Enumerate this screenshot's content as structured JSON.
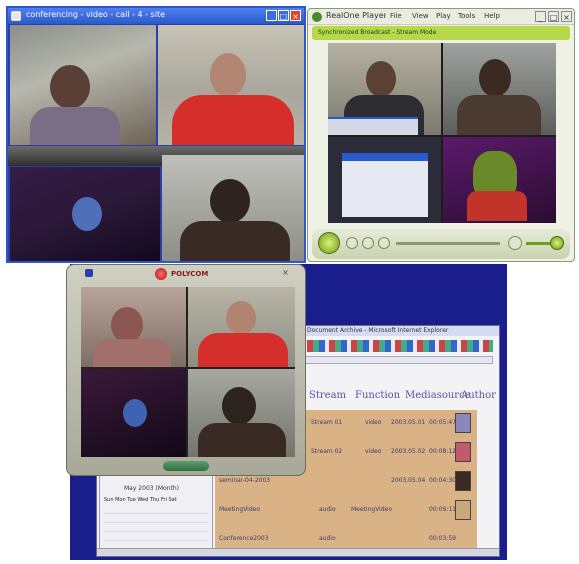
{
  "window_top_left": {
    "title": "conferencing - video - call - 4 - site",
    "tiles": [
      "participant-headset-woman",
      "participant-red-shirt-man",
      "animation-clip",
      "participant-phone-man"
    ]
  },
  "window_top_right": {
    "title": "RealOne Player",
    "menu": [
      "File",
      "View",
      "Play",
      "Tools",
      "Help"
    ],
    "address": "Synchronized Broadcast - Stream Mode",
    "tiles": [
      "participant-glasses-man",
      "participant-hand-chin-man",
      "app-dialog-screenshot",
      "puppet-clip"
    ]
  },
  "window_bottom_center": {
    "title": "POLYCOM",
    "tiles": [
      "participant-window-woman",
      "participant-red-shirt-man",
      "animation-clip",
      "participant-phone-man"
    ]
  },
  "browser_bottom": {
    "title": "Document Archive - Microsoft Internet Explorer",
    "headings": [
      "Stream",
      "Function",
      "Mediasource",
      "Author"
    ],
    "rows": [
      {
        "name": "Stream 01",
        "a": "video",
        "b": "2003.05.01",
        "c": "00:05:47"
      },
      {
        "name": "Stream 02",
        "a": "video",
        "b": "2003.05.02",
        "c": "00:08:12"
      },
      {
        "name": "seminar-04-2003",
        "a": "",
        "b": "2003.05.04",
        "c": "00:04:30"
      },
      {
        "name": "MeetingVideo",
        "a": "audio",
        "b": "MeetingVideo",
        "c": "00:09:11"
      },
      {
        "name": "Conference2003",
        "a": "audio",
        "b": "",
        "c": "00:03:59"
      }
    ],
    "calendar_month": "May 2003 (Month)",
    "calendar_days": [
      "Sun",
      "Mon",
      "Tue",
      "Wed",
      "Thu",
      "Fri",
      "Sat"
    ]
  },
  "colors": {
    "xp_blue": "#2a59c9",
    "realone_green": "#b5d94a",
    "polycom_gray": "#b8b8a8",
    "browser_tan": "#d9b385",
    "desktop_navy": "#1a1e8c"
  }
}
